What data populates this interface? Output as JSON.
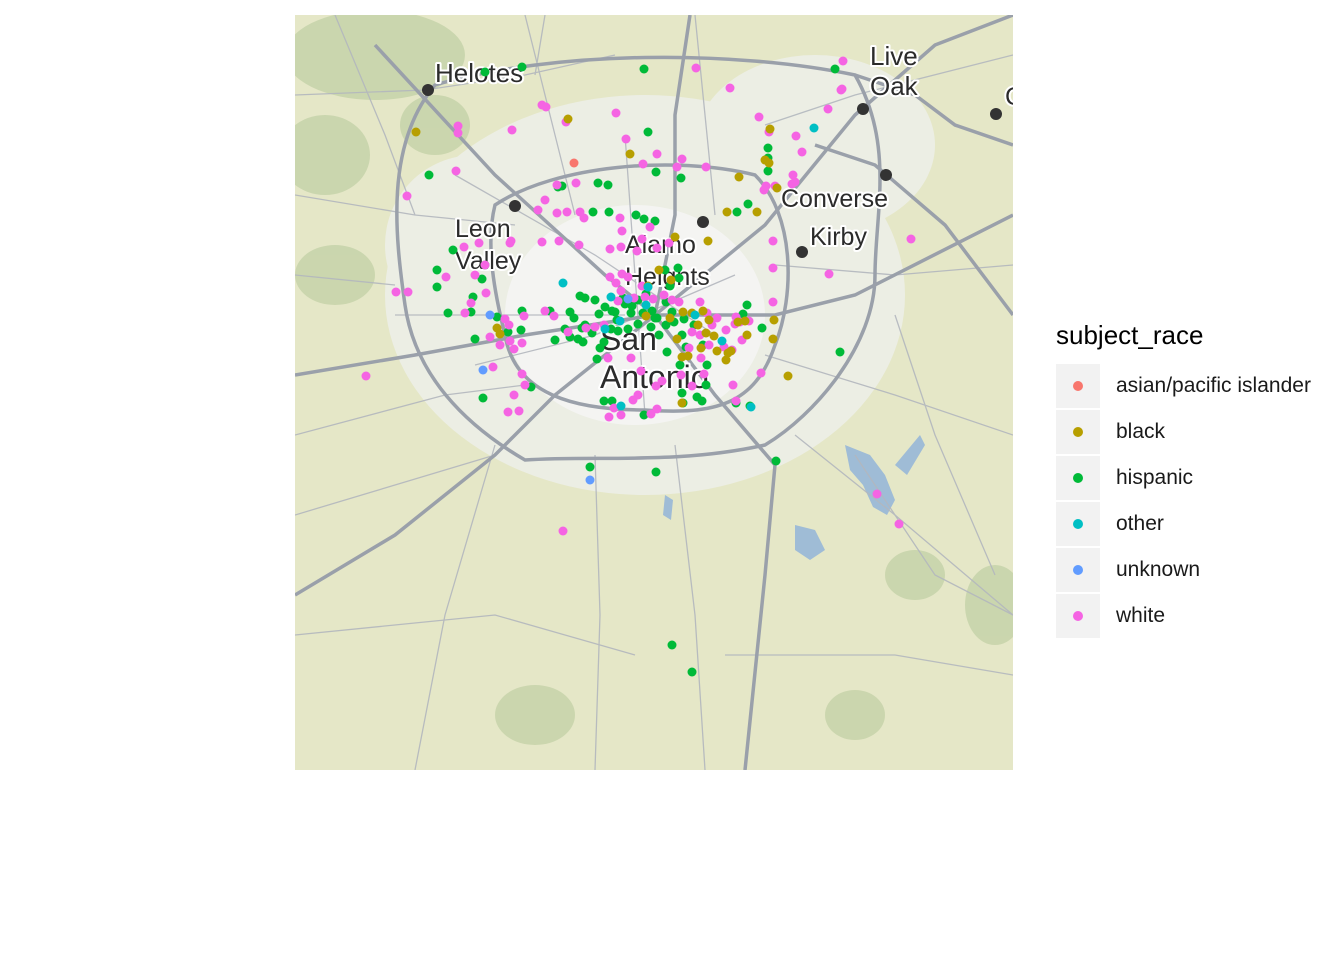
{
  "map": {
    "places": [
      {
        "id": "helotes",
        "lines": [
          "Helotes"
        ]
      },
      {
        "id": "live-oak",
        "lines": [
          "Live",
          "Oak"
        ]
      },
      {
        "id": "leon-valley",
        "lines": [
          "Leon",
          "Valley"
        ]
      },
      {
        "id": "converse",
        "lines": [
          "Converse"
        ]
      },
      {
        "id": "kirby",
        "lines": [
          "Kirby"
        ]
      },
      {
        "id": "alamo-heights",
        "lines": [
          "Alamo",
          "Heights"
        ]
      },
      {
        "id": "san-antonio",
        "lines": [
          "San",
          "Antonio"
        ]
      },
      {
        "id": "edge-city",
        "lines": [
          "C"
        ]
      }
    ],
    "colors": {
      "land": "#e5e7c7",
      "urban": "#e9ebe0",
      "road": "#9aa0aa",
      "water": "#9fbcd6",
      "forest": "#b6c9a0"
    }
  },
  "legend": {
    "title": "subject_race",
    "items": [
      {
        "key": "asian/pacific islander",
        "label": "asian/pacific islander",
        "color": "#F8766D"
      },
      {
        "key": "black",
        "label": "black",
        "color": "#B79F00"
      },
      {
        "key": "hispanic",
        "label": "hispanic",
        "color": "#00BA38"
      },
      {
        "key": "other",
        "label": "other",
        "color": "#00BFC4"
      },
      {
        "key": "unknown",
        "label": "unknown",
        "color": "#619CFF"
      },
      {
        "key": "white",
        "label": "white",
        "color": "#F564E3"
      }
    ]
  }
}
